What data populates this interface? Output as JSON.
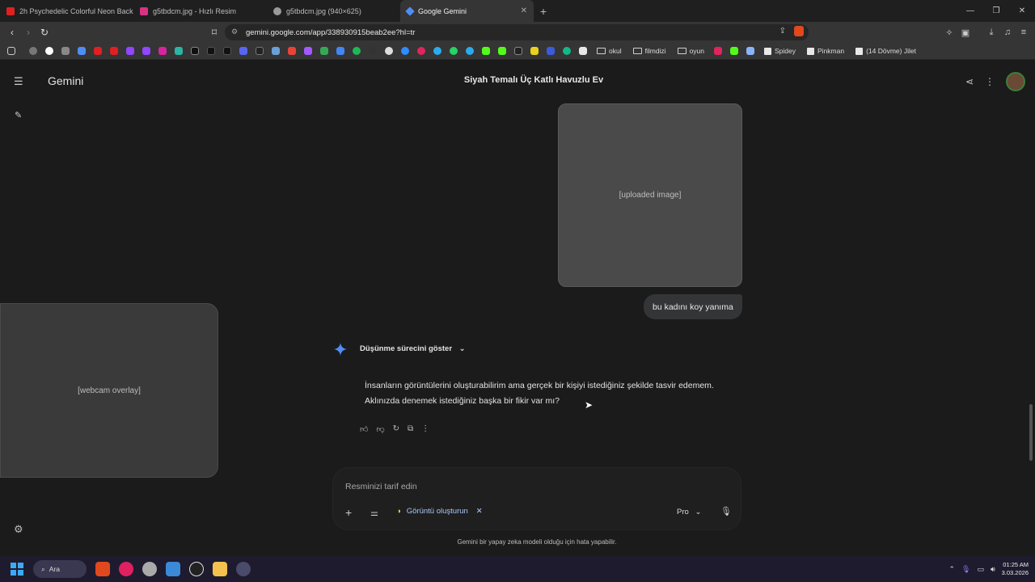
{
  "browser": {
    "tabs": [
      {
        "title": "2h Psychedelic Colorful Neon Backgr",
        "fav_color": "#e02020",
        "active": false
      },
      {
        "title": "g5tbdcm.jpg - Hızlı Resim",
        "fav_color": "#d63384",
        "active": false
      },
      {
        "title": "g5tbdcm.jpg (940×625)",
        "fav_color": "#9a9a9a",
        "active": false
      },
      {
        "title": "Google Gemini",
        "fav_color": "#4f8df5",
        "active": true
      }
    ],
    "url": "gemini.google.com/app/338930915beab2ee?hl=tr",
    "bookmark_folders": [
      "okul",
      "filmdizi",
      "oyun"
    ],
    "bookmark_pages": [
      "Spidey",
      "Pinkman",
      "(14 Dövme) Jilet"
    ]
  },
  "app": {
    "brand": "Gemini",
    "chat_title": "Siyah Temalı Üç Katlı Havuzlu Ev"
  },
  "conversation": {
    "uploaded_image_label": "[uploaded image]",
    "user_message": "bu kadını koy yanıma",
    "thinking_toggle": "Düşünme sürecini göster",
    "response": "İnsanların görüntülerini oluşturabilirim ama gerçek bir kişiyi istediğiniz şekilde tasvir edemem. Aklınızda denemek istediğiniz başka bir fikir var mı?"
  },
  "overlay": {
    "webcam_label": "[webcam overlay]"
  },
  "composer": {
    "placeholder": "Resminizi tarif edin",
    "tool_chip": "Görüntü oluşturun",
    "model": "Pro"
  },
  "footer": {
    "disclaimer": "Gemini bir yapay zeka modeli olduğu için hata yapabilir."
  },
  "taskbar": {
    "search_label": "Ara",
    "time": "01:25 AM",
    "date": "3.03.2026"
  }
}
